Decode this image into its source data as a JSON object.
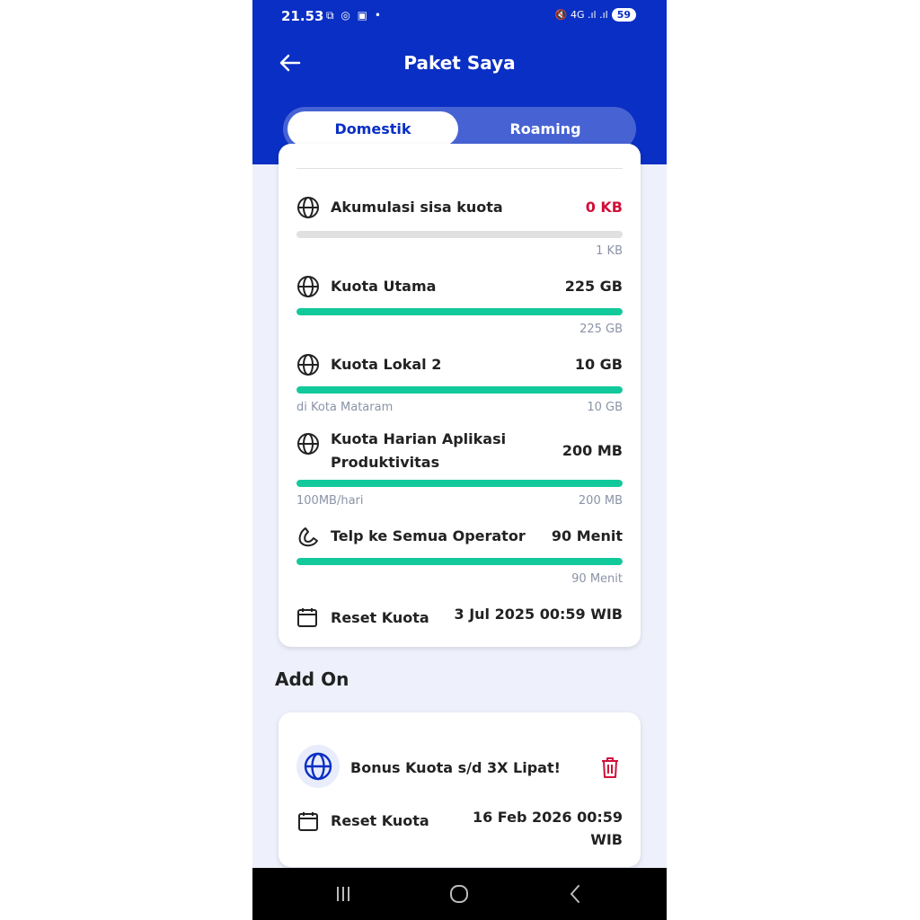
{
  "status_bar": {
    "time": "21.53",
    "notification_icons": "⧉ ◎ ▣ •",
    "signal": "🔇 4G .ıl .ıl",
    "battery": "59"
  },
  "header": {
    "title": "Paket Saya",
    "tabs": [
      {
        "label": "Domestik",
        "active": true
      },
      {
        "label": "Roaming",
        "active": false
      }
    ]
  },
  "quotas": [
    {
      "icon": "globe-icon",
      "label": "Akumulasi sisa kuota",
      "value": "0 KB",
      "value_color": "#d0103a",
      "fill": 0.0,
      "sub_left": "",
      "sub_right": "1 KB"
    },
    {
      "icon": "globe-icon",
      "label": "Kuota Utama",
      "value": "225 GB",
      "fill": 1.0,
      "sub_left": "",
      "sub_right": "225 GB"
    },
    {
      "icon": "globe-icon",
      "label": "Kuota Lokal 2",
      "value": "10 GB",
      "fill": 1.0,
      "sub_left": "di Kota Mataram",
      "sub_right": "10 GB"
    },
    {
      "icon": "globe-icon",
      "label_line1": "Kuota Harian Aplikasi",
      "label_line2": "Produktivitas",
      "value": "200 MB",
      "fill": 1.0,
      "sub_left": "100MB/hari",
      "sub_right": "200 MB"
    },
    {
      "icon": "phone-icon",
      "label": "Telp ke Semua Operator",
      "value": "90 Menit",
      "fill": 1.0,
      "sub_left": "",
      "sub_right": "90 Menit"
    }
  ],
  "reset_main": {
    "icon": "calendar-icon",
    "label": "Reset Kuota",
    "value": "3 Jul 2025 00:59 WIB"
  },
  "addon": {
    "section_title": "Add On",
    "name": "Bonus Kuota s/d 3X Lipat!",
    "reset_label": "Reset Kuota",
    "reset_value_line1": "16 Feb 2026 00:59",
    "reset_value_line2": "WIB"
  },
  "colors": {
    "brand": "#0a2fc4",
    "progress": "#12c99b",
    "alert": "#d0103a"
  }
}
